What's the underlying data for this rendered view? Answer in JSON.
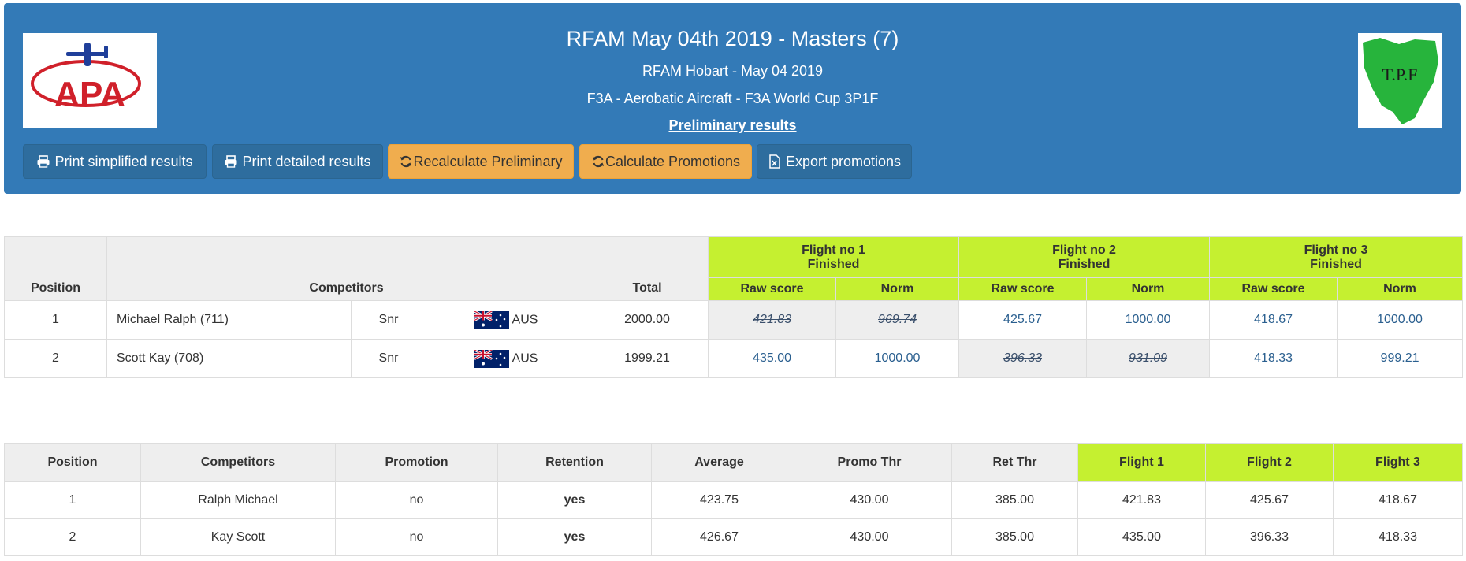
{
  "header": {
    "title": "RFAM May 04th 2019 - Masters (7)",
    "subtitle": "RFAM Hobart - May 04 2019",
    "category": "F3A - Aerobatic Aircraft - F3A World Cup 3P1F",
    "preliminary": "Preliminary results",
    "logo_left_text": "APA",
    "logo_right_text": "T.P.F"
  },
  "toolbar": {
    "print_simplified": "Print simplified results",
    "print_detailed": "Print detailed results",
    "recalculate": "Recalculate Preliminary",
    "calculate_promotions": "Calculate Promotions",
    "export_promotions": "Export promotions"
  },
  "colors": {
    "header_bg": "#337ab7",
    "button_dark": "#2e6d9e",
    "button_warning": "#f0ad4e",
    "flight_header": "#c5f030",
    "dropped_strike": "#cc0000"
  },
  "results": {
    "headers": {
      "position": "Position",
      "competitors": "Competitors",
      "total": "Total",
      "raw": "Raw score",
      "norm": "Norm"
    },
    "flights": [
      {
        "name": "Flight no 1",
        "status": "Finished"
      },
      {
        "name": "Flight no 2",
        "status": "Finished"
      },
      {
        "name": "Flight no 3",
        "status": "Finished"
      }
    ],
    "rows": [
      {
        "position": "1",
        "name": "Michael Ralph (711)",
        "class": "Snr",
        "country": "AUS",
        "total": "2000.00",
        "f1_raw": "421.83",
        "f1_norm": "969.74",
        "f2_raw": "425.67",
        "f2_norm": "1000.00",
        "f3_raw": "418.67",
        "f3_norm": "1000.00"
      },
      {
        "position": "2",
        "name": "Scott Kay (708)",
        "class": "Snr",
        "country": "AUS",
        "total": "1999.21",
        "f1_raw": "435.00",
        "f1_norm": "1000.00",
        "f2_raw": "396.33",
        "f2_norm": "931.09",
        "f3_raw": "418.33",
        "f3_norm": "999.21"
      }
    ]
  },
  "promotions": {
    "headers": {
      "position": "Position",
      "competitors": "Competitors",
      "promotion": "Promotion",
      "retention": "Retention",
      "average": "Average",
      "promo_thr": "Promo Thr",
      "ret_thr": "Ret Thr",
      "flight1": "Flight 1",
      "flight2": "Flight 2",
      "flight3": "Flight 3"
    },
    "rows": [
      {
        "position": "1",
        "name": "Ralph Michael",
        "promotion": "no",
        "retention": "yes",
        "average": "423.75",
        "promo_thr": "430.00",
        "ret_thr": "385.00",
        "f1": "421.83",
        "f2": "425.67",
        "f3": "418.67"
      },
      {
        "position": "2",
        "name": "Kay Scott",
        "promotion": "no",
        "retention": "yes",
        "average": "426.67",
        "promo_thr": "430.00",
        "ret_thr": "385.00",
        "f1": "435.00",
        "f2": "396.33",
        "f3": "418.33"
      }
    ]
  }
}
